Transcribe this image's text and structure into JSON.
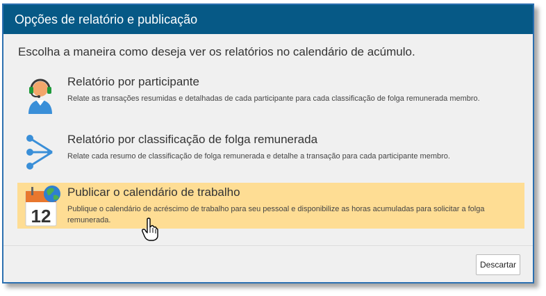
{
  "dialog": {
    "title": "Opções de relatório e publicação",
    "instruction": "Escolha a maneira como deseja ver os relatórios no calendário de acúmulo."
  },
  "options": [
    {
      "icon": "participant-headset-icon",
      "title": "Relatório por participante",
      "description": "Relate as transações resumidas e detalhadas de cada participante para cada classificação de folga remunerada membro."
    },
    {
      "icon": "branch-arrows-icon",
      "title": "Relatório por classificação de folga remunerada",
      "description": "Relate cada resumo de classificação de folga remunerada e detalhe a transação para cada participante membro."
    },
    {
      "icon": "calendar-globe-icon",
      "calendar_number": "12",
      "title": "Publicar o calendário de trabalho",
      "description": "Publique o calendário de acréscimo de trabalho para seu pessoal e disponibilize as horas acumuladas para solicitar a folga remunerada."
    }
  ],
  "footer": {
    "dismiss_label": "Descartar"
  },
  "colors": {
    "title_bar": "#065986",
    "highlight": "#fedd94",
    "dialog_border": "#2b6fb0",
    "icon_blue": "#3a8fd8",
    "calendar_orange": "#e8772e"
  }
}
